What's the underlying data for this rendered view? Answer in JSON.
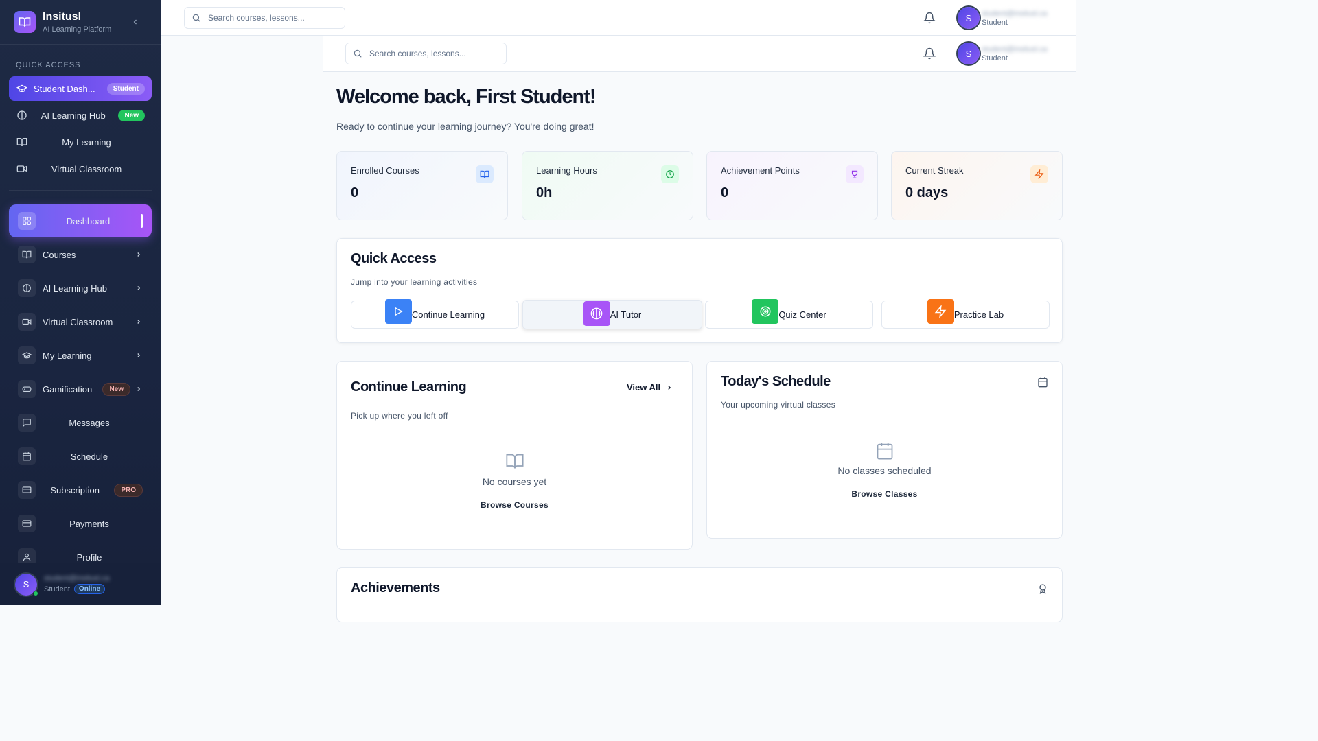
{
  "brand": {
    "name": "Insitusl",
    "subtitle": "AI Learning Platform"
  },
  "quick_access_label": "QUICK ACCESS",
  "quick_access": [
    {
      "label": "Student Dash...",
      "badge": "Student"
    },
    {
      "label": "AI Learning Hub",
      "badge": "New"
    },
    {
      "label": "My Learning"
    },
    {
      "label": "Virtual Classroom"
    }
  ],
  "nav": [
    {
      "label": "Dashboard"
    },
    {
      "label": "Courses"
    },
    {
      "label": "AI Learning Hub"
    },
    {
      "label": "Virtual Classroom"
    },
    {
      "label": "My Learning"
    },
    {
      "label": "Gamification",
      "badge": "New"
    },
    {
      "label": "Messages"
    },
    {
      "label": "Schedule"
    },
    {
      "label": "Subscription",
      "badge": "PRO"
    },
    {
      "label": "Payments"
    },
    {
      "label": "Profile"
    }
  ],
  "user": {
    "initial": "S",
    "email": "student@insitusl.ca",
    "role": "Student",
    "status": "Online"
  },
  "search": {
    "placeholder": "Search courses, lessons..."
  },
  "welcome": {
    "title": "Welcome back, First Student!",
    "subtitle": "Ready to continue your learning journey? You're doing great!"
  },
  "stats": [
    {
      "label": "Enrolled Courses",
      "value": "0",
      "icon": "book-icon",
      "color": "#3b82f6"
    },
    {
      "label": "Learning Hours",
      "value": "0h",
      "icon": "clock-icon",
      "color": "#22c55e"
    },
    {
      "label": "Achievement Points",
      "value": "0",
      "icon": "trophy-icon",
      "color": "#a855f7"
    },
    {
      "label": "Current Streak",
      "value": "0 days",
      "icon": "zap-icon",
      "color": "#f97316"
    }
  ],
  "quick_access_card": {
    "title": "Quick Access",
    "subtitle": "Jump into your learning activities",
    "buttons": [
      {
        "label": "Continue Learning",
        "icon": "play-icon",
        "color": "#3b82f6"
      },
      {
        "label": "AI Tutor",
        "icon": "brain-icon",
        "color": "#a855f7"
      },
      {
        "label": "Quiz Center",
        "icon": "target-icon",
        "color": "#22c55e"
      },
      {
        "label": "Practice Lab",
        "icon": "zap-icon",
        "color": "#f97316"
      }
    ]
  },
  "continue_learning": {
    "title": "Continue Learning",
    "view_all": "View All",
    "subtitle": "Pick up where you left off",
    "empty": "No courses yet",
    "action": "Browse Courses"
  },
  "schedule": {
    "title": "Today's Schedule",
    "subtitle": "Your upcoming virtual classes",
    "empty": "No classes scheduled",
    "action": "Browse Classes"
  },
  "achievements": {
    "title": "Achievements"
  }
}
